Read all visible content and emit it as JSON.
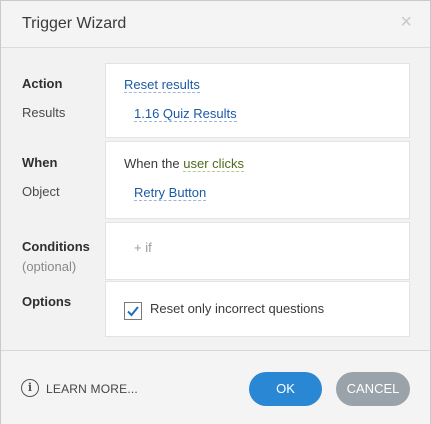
{
  "window": {
    "title": "Trigger Wizard",
    "close_glyph": "×"
  },
  "action": {
    "label": "Action",
    "value": "Reset results"
  },
  "results": {
    "label": "Results",
    "value": "1.16 Quiz Results"
  },
  "when": {
    "label": "When",
    "prefix": "When the",
    "value": "user clicks"
  },
  "object": {
    "label": "Object",
    "value": "Retry Button"
  },
  "conditions": {
    "label": "Conditions",
    "sublabel": "(optional)",
    "add_text": "+ if"
  },
  "options": {
    "label": "Options",
    "checkbox_label": "Reset only incorrect questions",
    "checked": true
  },
  "footer": {
    "learn_more": "LEARN MORE...",
    "ok": "OK",
    "cancel": "CANCEL"
  },
  "colors": {
    "primary": "#2a87d4",
    "secondary": "#9aa2aa",
    "link": "#1c5aa6"
  }
}
